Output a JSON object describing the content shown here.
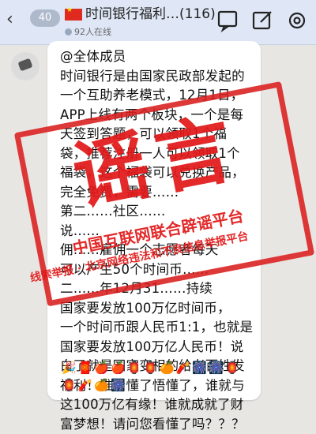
{
  "header": {
    "back_symbol": "‹",
    "unread_count": "40",
    "title": "时间银行福利…(116)",
    "online": "92人在线"
  },
  "message": {
    "lines": [
      "@全体成员",
      "时间银行是由国家民政部发起的",
      "一个互助养老模式，12月1日，",
      "APP上线有两个板块，一个是每",
      "天签到答题，可以领取1个福",
      "袋，推荐注册一人可以领取1个",
      "福袋，这个福袋可以兑换产品，",
      "完全免费，需要……",
      "第二……社区……",
      "说……",
      "佣……雇佣一个志愿者每天",
      "可以产生50个时间币……",
      "二……年12月31……持续",
      "国家要发放100万亿时间币，",
      "一个时间币跟人民币1:1，也就是",
      "国家要发放100万亿人民币！说",
      "白了就是国家变相的给老百姓发",
      "福利！谁看懂了悟懂了，谁就与",
      "这100万亿有缘！谁就成就了财",
      "富梦想！请问您看懂了吗？？？"
    ],
    "emoji": "🎉🧧🍎🍎🏮🏮🍊🧨🎆🎆🏮🏮🧨🍊🎆"
  },
  "stamp": {
    "big_text": "谣言",
    "line1": "中国互联网联合辟谣平台",
    "line2": "线索举报 · 北京网络违法和不良信息举报平台",
    "color": "#e01919"
  },
  "colors": {
    "header_bg": "#dfe7f6",
    "chat_bg": "#e8e6e3",
    "bubble_bg": "#ffffff"
  }
}
